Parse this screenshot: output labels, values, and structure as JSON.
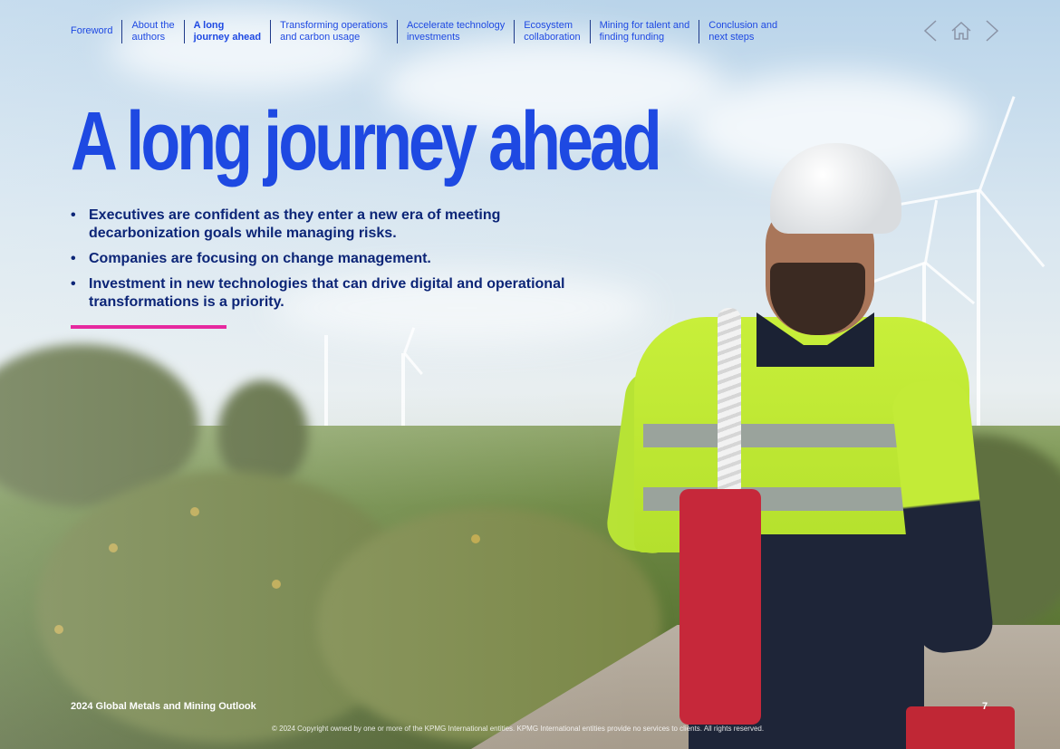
{
  "nav": {
    "items": [
      {
        "label": "Foreword",
        "active": false
      },
      {
        "label": "About the\nauthors",
        "active": false
      },
      {
        "label": "A long\njourney ahead",
        "active": true
      },
      {
        "label": "Transforming operations\nand carbon usage",
        "active": false
      },
      {
        "label": "Accelerate technology\ninvestments",
        "active": false
      },
      {
        "label": "Ecosystem\ncollaboration",
        "active": false
      },
      {
        "label": "Mining for talent and\nfinding funding",
        "active": false
      },
      {
        "label": "Conclusion and\nnext steps",
        "active": false
      }
    ],
    "controls": {
      "prev_icon": "chevron-left-icon",
      "home_icon": "home-icon",
      "next_icon": "chevron-right-icon"
    }
  },
  "hero": {
    "title": "A long journey ahead",
    "bullets": [
      "Executives are confident as they enter a new era of meeting decarbonization goals while managing risks.",
      "Companies are focusing on change management.",
      "Investment in new technologies that can drive digital and operational transformations is a priority."
    ]
  },
  "footer": {
    "publication": "2024 Global Metals and Mining Outlook",
    "page_number": "7",
    "copyright": "© 2024 Copyright owned by one or more of the KPMG International entities. KPMG International entities provide no services to clients. All rights reserved."
  },
  "colors": {
    "brand_blue": "#1e49e2",
    "dark_blue": "#0c2577",
    "accent_pink": "#e6299f"
  }
}
